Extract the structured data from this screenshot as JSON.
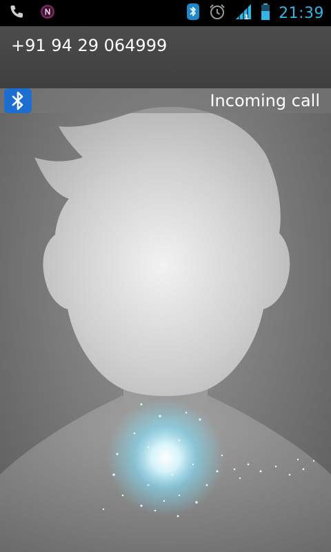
{
  "status_bar": {
    "time": "21:39",
    "icons": [
      "phone-icon",
      "n-notification-icon",
      "bluetooth-icon",
      "alarm-icon",
      "signal-icon",
      "battery-icon"
    ],
    "accent_color": "#33b5e5",
    "signal_sim_label": "1"
  },
  "call": {
    "number": "+91 94 29 064999",
    "state": "Incoming call",
    "audio_route_icon": "bluetooth-icon",
    "bluetooth_color": "#1c6fd1"
  },
  "contact": {
    "photo": "default-avatar-silhouette"
  },
  "answer_widget": {
    "icon": "sparkle-glow-icon",
    "glow_color": "#7fe3ff"
  }
}
